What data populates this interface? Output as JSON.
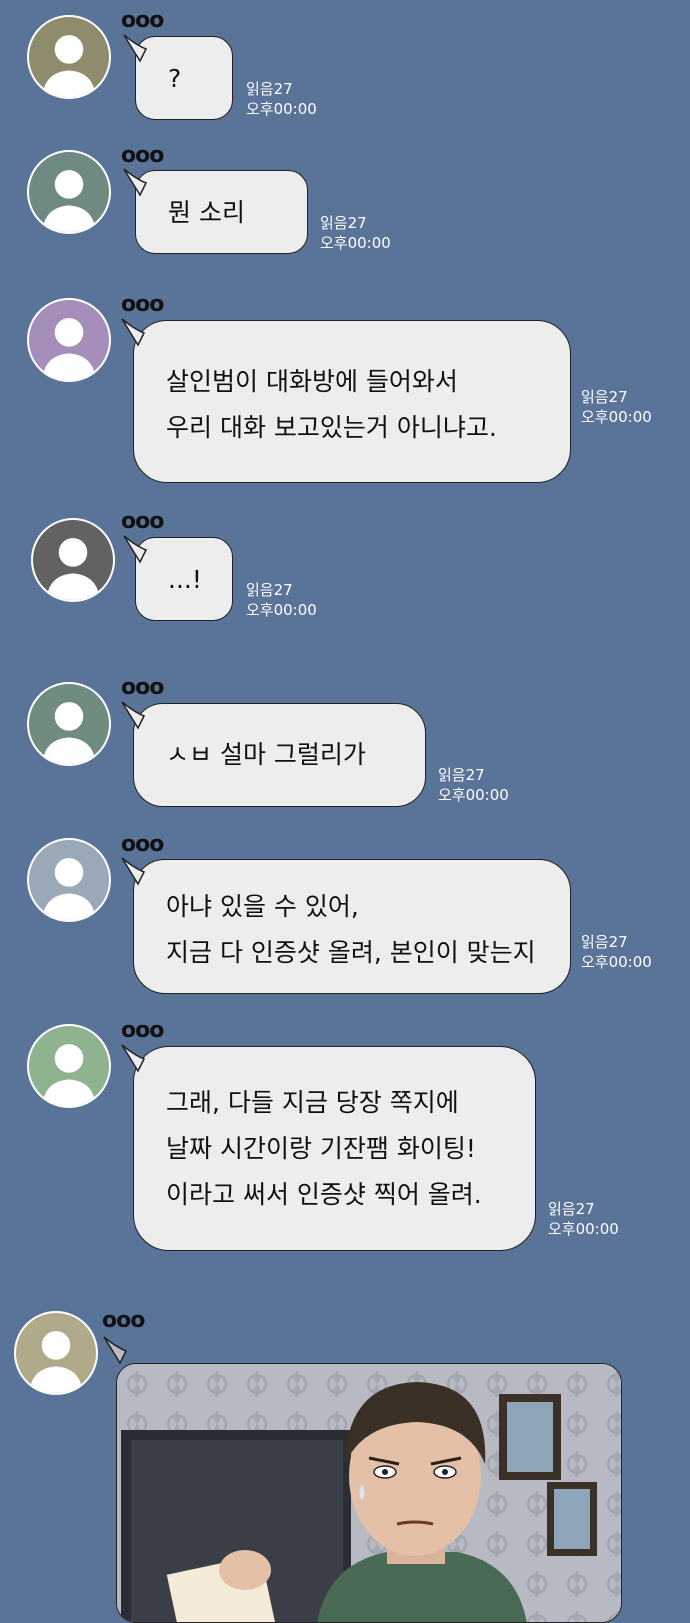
{
  "messages": [
    {
      "sender": "ooo",
      "lines": [
        "?"
      ],
      "read": "읽음27",
      "time": "오후00:00",
      "avatar_color": "#8e8c6c"
    },
    {
      "sender": "ooo",
      "lines": [
        "뭔 소리"
      ],
      "read": "읽음27",
      "time": "오후00:00",
      "avatar_color": "#6e8a82"
    },
    {
      "sender": "ooo",
      "lines": [
        "살인범이 대화방에 들어와서",
        "우리 대화 보고있는거 아니냐고."
      ],
      "read": "읽음27",
      "time": "오후00:00",
      "avatar_color": "#a58fba"
    },
    {
      "sender": "ooo",
      "lines": [
        "...!"
      ],
      "read": "읽음27",
      "time": "오후00:00",
      "avatar_color": "#626262"
    },
    {
      "sender": "ooo",
      "lines": [
        "ㅅㅂ 설마 그럴리가"
      ],
      "read": "읽음27",
      "time": "오후00:00",
      "avatar_color": "#6f8c7e"
    },
    {
      "sender": "ooo",
      "lines": [
        "아냐 있을 수 있어,",
        "지금 다 인증샷 올려, 본인이 맞는지"
      ],
      "read": "읽음27",
      "time": "오후00:00",
      "avatar_color": "#9aa9b8"
    },
    {
      "sender": "ooo",
      "lines": [
        "그래, 다들 지금 당장 쪽지에",
        "날짜 시간이랑 기잔팸 화이팅!",
        "이라고 써서 인증샷 찍어 올려."
      ],
      "read": "읽음27",
      "time": "오후00:00",
      "avatar_color": "#8fb38f"
    },
    {
      "sender": "ooo",
      "avatar_color": "#b0a98a"
    }
  ],
  "colors": {
    "background": "#5a7399",
    "bubble": "#ededee",
    "meta_text": "#ffffff"
  },
  "icons": {
    "avatar": "person-silhouette-icon"
  }
}
